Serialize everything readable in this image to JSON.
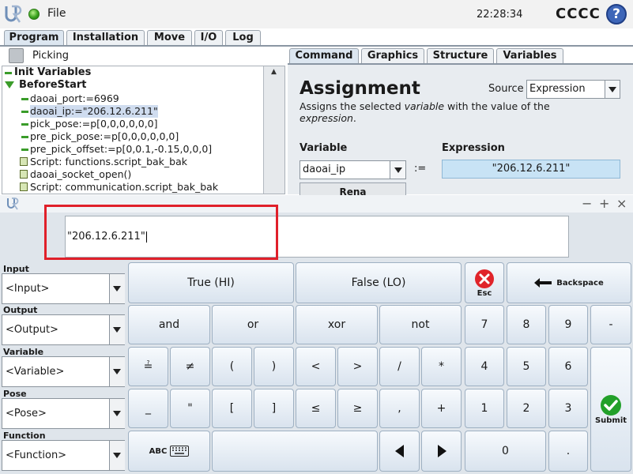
{
  "header": {
    "file_menu": "File",
    "clock": "22:28:34",
    "robot_name": "CCCC",
    "help": "?"
  },
  "main_tabs": [
    "Program",
    "Installation",
    "Move",
    "I/O",
    "Log"
  ],
  "program_name": "Picking",
  "tree": {
    "rows": [
      "Init Variables",
      "BeforeStart",
      "daoai_port:=6969",
      "daoai_ip:=\"206.12.6.211\"",
      "pick_pose:=p[0,0,0,0,0,0]",
      "pre_pick_pose:=p[0,0,0,0,0,0]",
      "pre_pick_offset:=p[0,0.1,-0.15,0,0,0]",
      "Script: functions.script_bak_bak",
      "daoai_socket_open()",
      "Script: communication.script_bak_bak"
    ],
    "scroll_up": "▲"
  },
  "command_tabs": [
    "Command",
    "Graphics",
    "Structure",
    "Variables"
  ],
  "command": {
    "title": "Assignment",
    "source_label": "Source",
    "source_value": "Expression",
    "desc_part1": "Assigns the selected ",
    "desc_em1": "variable",
    "desc_part2": " with the value of the ",
    "desc_em2": "expression",
    "desc_part3": ".",
    "variable_label": "Variable",
    "variable_value": "daoai_ip",
    "assign_op": ":=",
    "expression_label": "Expression",
    "expression_value": "\"206.12.6.211\"",
    "rename_button": "Rena"
  },
  "editor": {
    "window_controls": [
      "−",
      "+",
      "×"
    ],
    "input_value": "\"206.12.6.211\"",
    "groups": [
      {
        "label": "Input",
        "value": "<Input>"
      },
      {
        "label": "Output",
        "value": "<Output>"
      },
      {
        "label": "Variable",
        "value": "<Variable>"
      },
      {
        "label": "Pose",
        "value": "<Pose>"
      },
      {
        "label": "Function",
        "value": "<Function>"
      }
    ],
    "keys": {
      "true_hi": "True (HI)",
      "false_lo": "False (LO)",
      "esc": "Esc",
      "backspace": "Backspace",
      "and": "and",
      "or": "or",
      "xor": "xor",
      "not": "not",
      "equals": "≟",
      "not_equal": "≠",
      "lparen": "(",
      "rparen": ")",
      "lt": "<",
      "gt": ">",
      "divide": "/",
      "multiply": "*",
      "underscore": "_",
      "quote": "\"",
      "lbracket": "[",
      "rbracket": "]",
      "le": "≤",
      "ge": "≥",
      "comma": ",",
      "plus": "+",
      "n7": "7",
      "n8": "8",
      "n9": "9",
      "minus": "-",
      "n4": "4",
      "n5": "5",
      "n6": "6",
      "n1": "1",
      "n2": "2",
      "n3": "3",
      "n0": "0",
      "dot": ".",
      "abc": "ABC",
      "submit": "Submit"
    }
  }
}
